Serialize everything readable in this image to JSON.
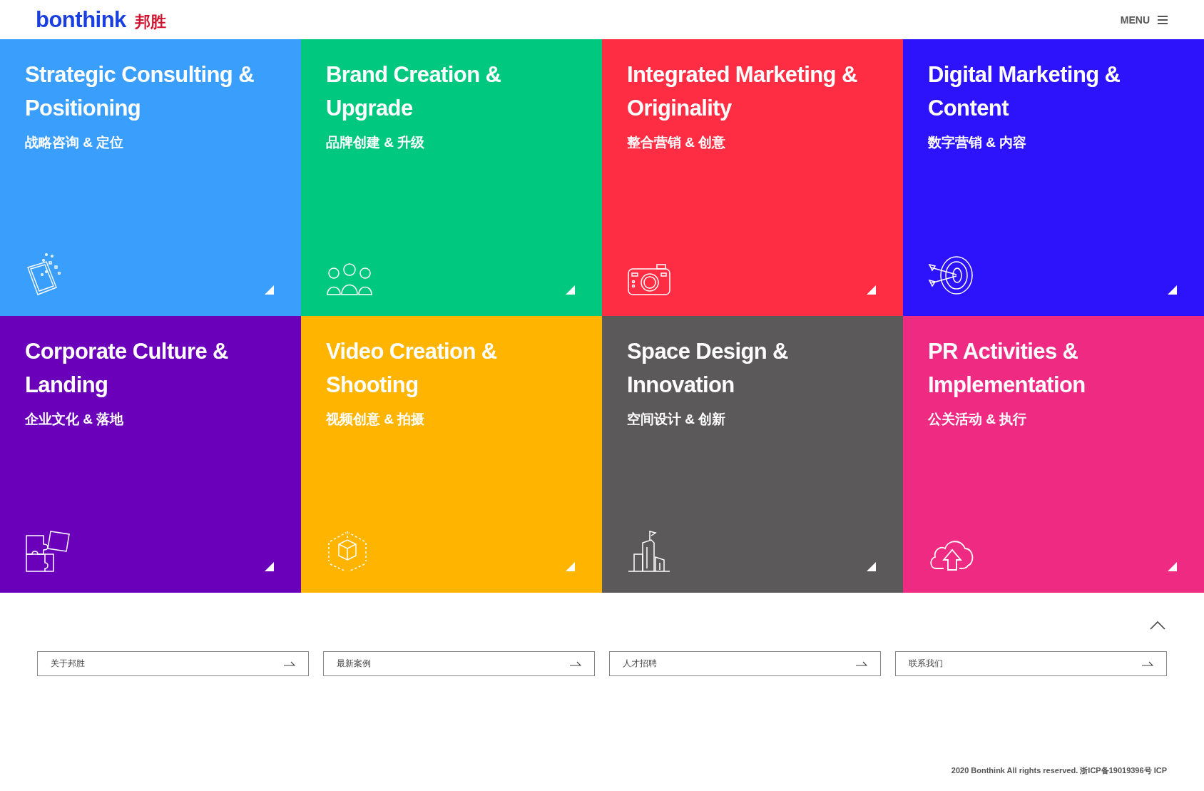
{
  "header": {
    "logo_text": "bonthink",
    "logo_cn": "邦胜",
    "menu_label": "MENU"
  },
  "tiles": [
    {
      "title": "Strategic Consulting & Positioning",
      "subtitle": "战略咨询 & 定位",
      "color": "#3a9efc",
      "kind": "tablet"
    },
    {
      "title": "Brand Creation & Upgrade",
      "subtitle": "品牌创建 & 升级",
      "color": "#00c97f",
      "kind": "people"
    },
    {
      "title": "Integrated Marketing & Originality",
      "subtitle": "整合营销 & 创意",
      "color": "#fe2d43",
      "kind": "camera"
    },
    {
      "title": "Digital Marketing & Content",
      "subtitle": "数字营销 & 内容",
      "color": "#2d13fb",
      "kind": "target"
    },
    {
      "title": "Corporate Culture & Landing",
      "subtitle": "企业文化 & 落地",
      "color": "#6a00b9",
      "kind": "puzzle"
    },
    {
      "title": "Video Creation & Shooting",
      "subtitle": "视频创意 & 拍摄",
      "color": "#ffb500",
      "kind": "cube"
    },
    {
      "title": "Space Design & Innovation",
      "subtitle": "空间设计 & 创新",
      "color": "#5b5959",
      "kind": "buildings"
    },
    {
      "title": "PR Activities & Implementation",
      "subtitle": "公关活动 & 执行",
      "color": "#ef2a82",
      "kind": "cloud"
    }
  ],
  "footer_links": [
    "关于邦胜",
    "最新案例",
    "人才招聘",
    "联系我们"
  ],
  "copyright": "2020 Bonthink All rights reserved. 浙ICP备19019396号 ICP"
}
